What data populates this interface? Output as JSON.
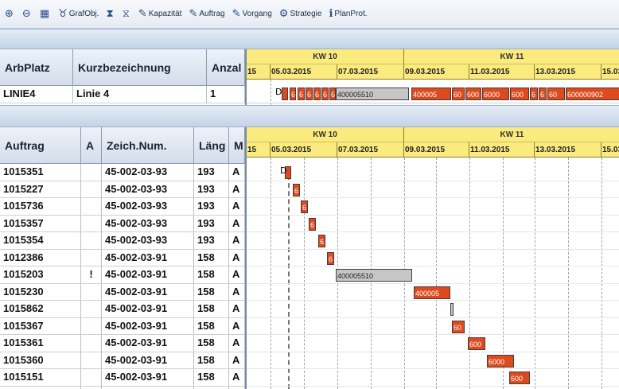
{
  "toolbar": [
    {
      "name": "zoom-in-button",
      "icon": "zoom-in-icon",
      "glyph": "⊕",
      "label": ""
    },
    {
      "name": "zoom-out-button",
      "icon": "zoom-out-icon",
      "glyph": "⊖",
      "label": ""
    },
    {
      "name": "layout-button",
      "icon": "grid-icon",
      "glyph": "▦",
      "label": ""
    },
    {
      "name": "grafobj-button",
      "icon": "binoculars-icon",
      "glyph": "♉",
      "label": "GrafObj."
    },
    {
      "name": "filter-button",
      "icon": "filter-icon",
      "glyph": "⧗",
      "label": ""
    },
    {
      "name": "filter-clear-button",
      "icon": "filter-clear-icon",
      "glyph": "⧖",
      "label": ""
    },
    {
      "name": "kapazitaet-button",
      "icon": "pencil-icon",
      "glyph": "✎",
      "label": "Kapazität"
    },
    {
      "name": "auftrag-button",
      "icon": "pencil-icon",
      "glyph": "✎",
      "label": "Auftrag"
    },
    {
      "name": "vorgang-button",
      "icon": "pencil-icon",
      "glyph": "✎",
      "label": "Vorgang"
    },
    {
      "name": "strategie-button",
      "icon": "strategy-icon",
      "glyph": "⚙",
      "label": "Strategie"
    },
    {
      "name": "planprot-button",
      "icon": "info-icon",
      "glyph": "ℹ",
      "label": "PlanProt."
    }
  ],
  "timeline": {
    "weeks": [
      "KW 10",
      "KW 11"
    ],
    "dates": [
      "15",
      "05.03.2015",
      "07.03.2015",
      "09.03.2015",
      "11.03.2015",
      "13.03.2015",
      "15.03"
    ]
  },
  "top_table": {
    "headers": [
      "ArbPlatz",
      "Kurzbezeichnung",
      "Anzal"
    ],
    "row": [
      "LINIE4",
      "Linie 4",
      "1"
    ]
  },
  "top_bars": [
    {
      "label": "",
      "color": "or"
    },
    {
      "label": "6",
      "color": "or"
    },
    {
      "label": "6",
      "color": "or"
    },
    {
      "label": "6",
      "color": "or"
    },
    {
      "label": "6",
      "color": "or"
    },
    {
      "label": "6",
      "color": "or"
    },
    {
      "label": "6",
      "color": "or"
    },
    {
      "label": "400005510",
      "color": "gr"
    },
    {
      "label": "400005",
      "color": "or"
    },
    {
      "label": "60",
      "color": "or"
    },
    {
      "label": "600",
      "color": "or"
    },
    {
      "label": "6000",
      "color": "or"
    },
    {
      "label": "600",
      "color": "or"
    },
    {
      "label": "6",
      "color": "or"
    },
    {
      "label": "6",
      "color": "or"
    },
    {
      "label": "60",
      "color": "or"
    },
    {
      "label": "600000902",
      "color": "or"
    }
  ],
  "bottom_table": {
    "headers": [
      "Auftrag",
      "A",
      "Zeich.Num.",
      "Läng",
      "M"
    ],
    "rows": [
      [
        "1015351",
        "",
        "45-002-03-93",
        "193",
        "A"
      ],
      [
        "1015227",
        "",
        "45-002-03-93",
        "193",
        "A"
      ],
      [
        "1015736",
        "",
        "45-002-03-93",
        "193",
        "A"
      ],
      [
        "1015357",
        "",
        "45-002-03-93",
        "193",
        "A"
      ],
      [
        "1015354",
        "",
        "45-002-03-93",
        "193",
        "A"
      ],
      [
        "1012386",
        "",
        "45-002-03-91",
        "158",
        "A"
      ],
      [
        "1015203",
        "!",
        "45-002-03-91",
        "158",
        "A"
      ],
      [
        "1015230",
        "",
        "45-002-03-91",
        "158",
        "A"
      ],
      [
        "1015862",
        "",
        "45-002-03-91",
        "158",
        "A"
      ],
      [
        "1015367",
        "",
        "45-002-03-91",
        "158",
        "A"
      ],
      [
        "1015361",
        "",
        "45-002-03-91",
        "158",
        "A"
      ],
      [
        "1015360",
        "",
        "45-002-03-91",
        "158",
        "A"
      ],
      [
        "1015151",
        "",
        "45-002-03-91",
        "158",
        "A"
      ],
      [
        "1015366",
        "",
        "45-002-03-91",
        "158",
        "A"
      ]
    ]
  },
  "order_bars": [
    {
      "label": "",
      "color": "or"
    },
    {
      "label": "6",
      "color": "or"
    },
    {
      "label": "6",
      "color": "or"
    },
    {
      "label": "6",
      "color": "or"
    },
    {
      "label": "6",
      "color": "or"
    },
    {
      "label": "6",
      "color": "or"
    },
    {
      "label": "400005510",
      "color": "gr"
    },
    {
      "label": "400005",
      "color": "or"
    },
    {
      "label": "",
      "color": "gr"
    },
    {
      "label": "60",
      "color": "or"
    },
    {
      "label": "600",
      "color": "or"
    },
    {
      "label": "6000",
      "color": "or"
    },
    {
      "label": "600",
      "color": "or"
    },
    {
      "label": "",
      "color": "or"
    }
  ],
  "colors": {
    "bar": "#dc4a1d",
    "bar_gray": "#c6c6c6",
    "header_yellow": "#fbea7e",
    "bar_blue": "#2d49a6"
  }
}
